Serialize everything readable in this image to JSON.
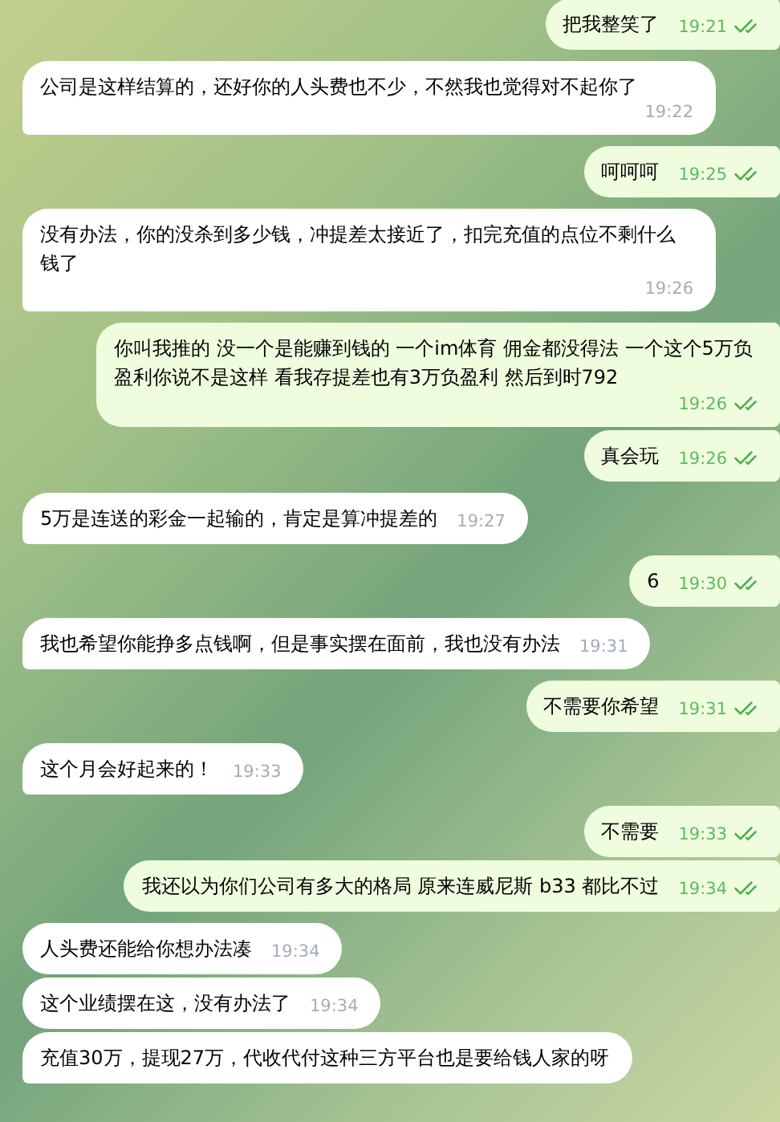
{
  "messages": [
    {
      "kind": "out",
      "text": "把我整笑了",
      "time": "19:21",
      "read": true
    },
    {
      "kind": "in",
      "text": "公司是这样结算的，还好你的人头费也不少，不然我也觉得对不起你了",
      "time": "19:22"
    },
    {
      "kind": "out",
      "text": "呵呵呵",
      "time": "19:25",
      "read": true
    },
    {
      "kind": "in",
      "text": "没有办法，你的没杀到多少钱，冲提差太接近了，扣完充值的点位不剩什么钱了",
      "time": "19:26"
    },
    {
      "kind": "out",
      "text": "你叫我推的 没一个是能赚到钱的 一个im体育 佣金都没得法 一个这个5万负盈利你说不是这样  看我存提差也有3万负盈利 然后到时792",
      "time": "19:26",
      "read": true
    },
    {
      "kind": "out",
      "text": "真会玩",
      "time": "19:26",
      "read": true
    },
    {
      "kind": "in",
      "text": "5万是连送的彩金一起输的，肯定是算冲提差的",
      "time": "19:27"
    },
    {
      "kind": "out",
      "text": "6",
      "time": "19:30",
      "read": true
    },
    {
      "kind": "in",
      "text": "我也希望你能挣多点钱啊，但是事实摆在面前，我也没有办法",
      "time": "19:31"
    },
    {
      "kind": "out",
      "text": "不需要你希望",
      "time": "19:31",
      "read": true
    },
    {
      "kind": "in",
      "text": "这个月会好起来的！",
      "time": "19:33"
    },
    {
      "kind": "out",
      "text": "不需要",
      "time": "19:33",
      "read": true
    },
    {
      "kind": "out",
      "text": "我还以为你们公司有多大的格局 原来连威尼斯 b33 都比不过",
      "time": "19:34",
      "read": true
    },
    {
      "kind": "in",
      "text": "人头费还能给你想办法凑",
      "time": "19:34"
    },
    {
      "kind": "in",
      "text": "这个业绩摆在这，没有办法了",
      "time": "19:34"
    },
    {
      "kind": "in",
      "text": "充值30万，提现27万，代收代付这种三方平台也是要给钱人家的呀"
    }
  ]
}
